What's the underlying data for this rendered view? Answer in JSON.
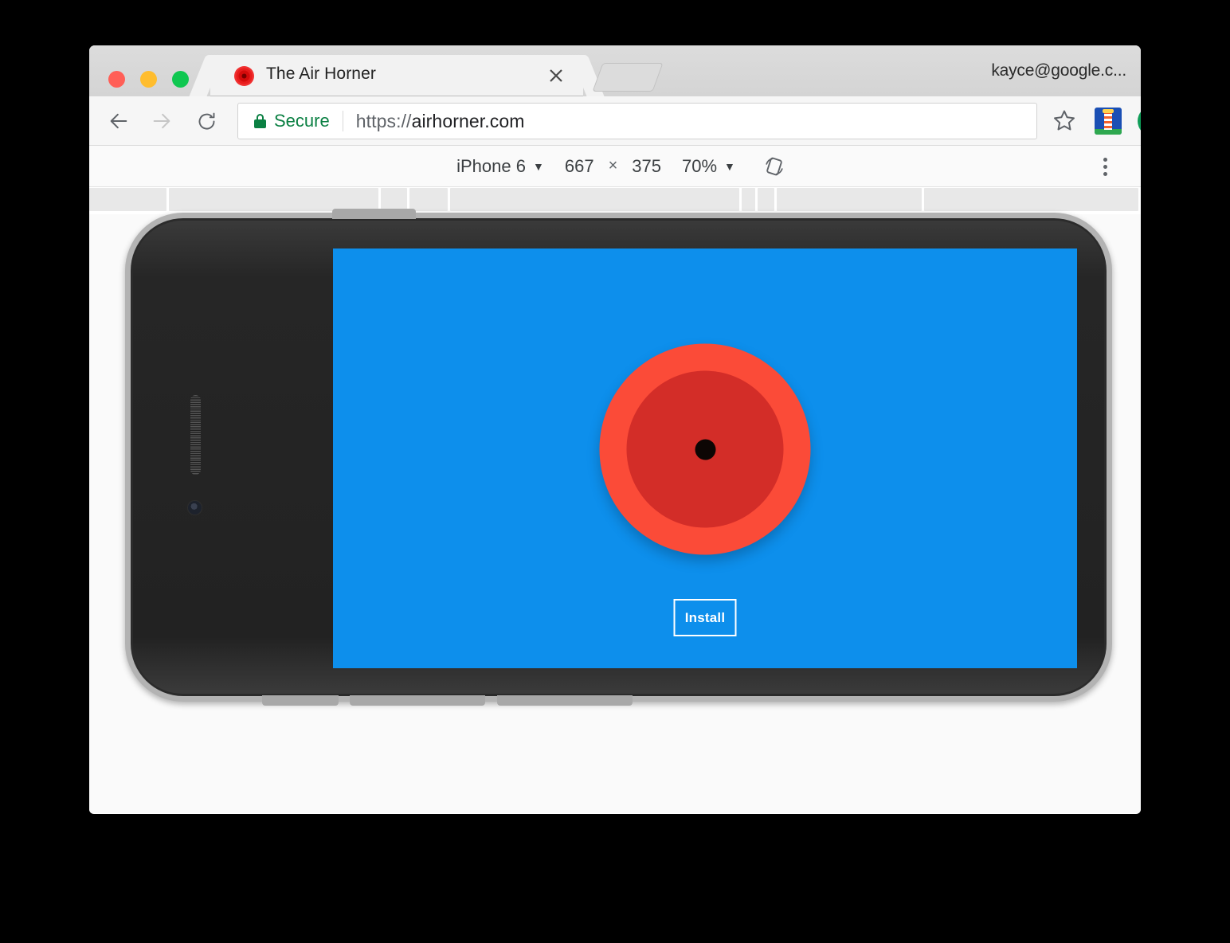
{
  "window": {
    "traffic_lights": [
      {
        "name": "close",
        "color": "#ff5f57"
      },
      {
        "name": "minimize",
        "color": "#ffbd2e"
      },
      {
        "name": "zoom",
        "color": "#0fc750"
      }
    ],
    "account_label": "kayce@google.c..."
  },
  "tab": {
    "title": "The Air Horner",
    "favicon": "airhorn-favicon",
    "close_icon": "close-icon",
    "new_tab_icon": "new-tab-button"
  },
  "toolbar": {
    "back_icon": "back-arrow-icon",
    "forward_icon": "forward-arrow-icon",
    "reload_icon": "reload-icon",
    "security_icon": "lock-icon",
    "security_label": "Secure",
    "url_scheme": "https://",
    "url_host": "airhorner.com",
    "star_icon": "bookmark-star-icon",
    "extension_icon": "lighthouse-extension-icon",
    "upload_icon": "upload-share-icon",
    "secure_color": "#0b8043"
  },
  "device_bar": {
    "device_name": "iPhone 6",
    "device_caret": "▼",
    "width": "667",
    "times": "×",
    "height": "375",
    "zoom": "70%",
    "zoom_caret": "▼",
    "rotate_icon": "rotate-device-icon",
    "menu_icon": "more-options-icon"
  },
  "bookmarks_bar": {
    "segments": [
      126,
      340,
      44,
      62,
      470,
      22,
      28,
      236,
      348
    ]
  },
  "phone": {
    "frame_color": "#2b2b2b",
    "bezel_edge_color": "#b3b3b3",
    "speaker_icon": "speaker-grille",
    "camera_icon": "front-camera",
    "home_icon": "home-button",
    "volume_buttons": [
      "volume-up-button",
      "volume-down-button",
      "silent-switch"
    ],
    "power_button": "power-button"
  },
  "app": {
    "screen_color": "#0d8fec",
    "horn_outer_color": "#fb4b38",
    "horn_inner_color": "#d32d28",
    "horn_dot_color": "#0d0604",
    "horn_label": "air-horn-button",
    "install_label": "Install"
  }
}
